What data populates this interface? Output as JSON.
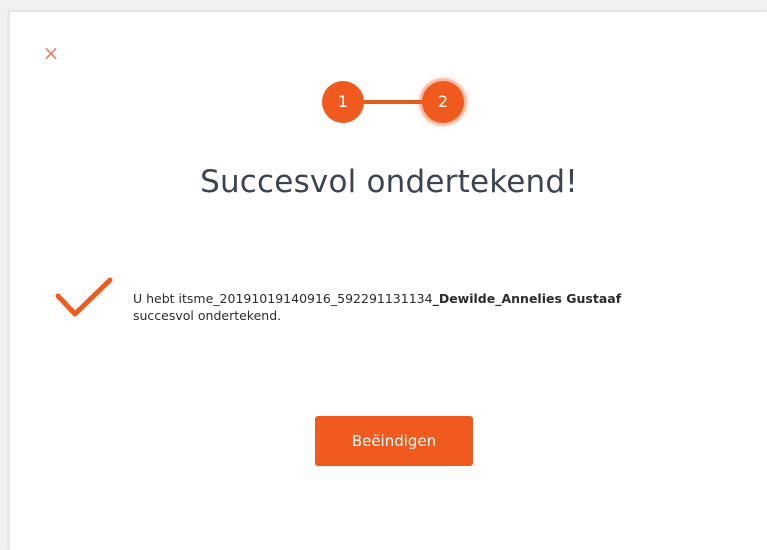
{
  "dialog": {
    "close_symbol": "×",
    "close_icon": "close-icon",
    "accent_color": "#f15a1f"
  },
  "stepper": {
    "steps": [
      {
        "label": "1",
        "state": "completed"
      },
      {
        "label": "2",
        "state": "active"
      }
    ]
  },
  "title": "Succesvol ondertekend!",
  "message": {
    "icon": "checkmark-icon",
    "prefix": "U hebt itsme_20191019140916_592291131134",
    "bold": "_Dewilde_Annelies Gustaaf",
    "suffix": "succesvol ondertekend."
  },
  "finish_button": {
    "label": "Beëindigen"
  }
}
